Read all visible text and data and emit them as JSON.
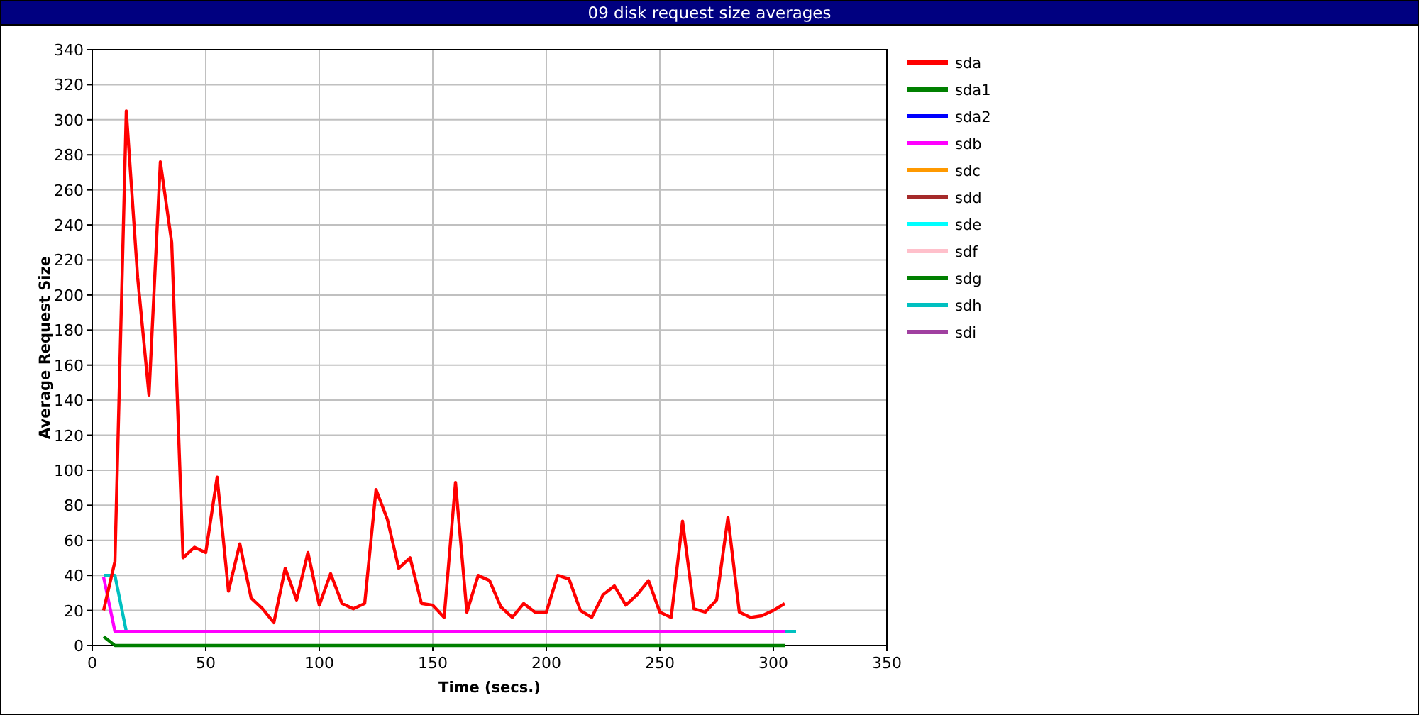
{
  "window": {
    "title": "09 disk request size averages"
  },
  "chart_data": {
    "type": "line",
    "grid": true,
    "legend": true,
    "xlabel": "Time (secs.)",
    "ylabel": "Average Request Size",
    "xlim": [
      0,
      350
    ],
    "ylim": [
      0,
      340
    ],
    "xticks": [
      0,
      50,
      100,
      150,
      200,
      250,
      300,
      350
    ],
    "yticks": [
      0,
      20,
      40,
      60,
      80,
      100,
      120,
      140,
      160,
      180,
      200,
      220,
      240,
      260,
      280,
      300,
      320,
      340
    ],
    "x": [
      5,
      10,
      15,
      20,
      25,
      30,
      35,
      40,
      45,
      50,
      55,
      60,
      65,
      70,
      75,
      80,
      85,
      90,
      95,
      100,
      105,
      110,
      115,
      120,
      125,
      130,
      135,
      140,
      145,
      150,
      155,
      160,
      165,
      170,
      175,
      180,
      185,
      190,
      195,
      200,
      205,
      210,
      215,
      220,
      225,
      230,
      235,
      240,
      245,
      250,
      255,
      260,
      265,
      270,
      275,
      280,
      285,
      290,
      295,
      300,
      305,
      310
    ],
    "series": [
      {
        "name": "sda",
        "color": "#ff0000",
        "values": [
          20,
          48,
          305,
          210,
          143,
          276,
          230,
          50,
          56,
          53,
          96,
          31,
          58,
          27,
          21,
          13,
          44,
          26,
          53,
          23,
          41,
          24,
          21,
          24,
          89,
          72,
          44,
          50,
          24,
          23,
          16,
          93,
          19,
          40,
          37,
          22,
          16,
          24,
          19,
          19,
          40,
          38,
          20,
          16,
          29,
          34,
          23,
          29,
          37,
          19,
          16,
          71,
          21,
          19,
          26,
          73,
          19,
          16,
          17,
          20,
          24,
          null
        ]
      },
      {
        "name": "sda1",
        "color": "#008000",
        "values": [
          null,
          null,
          null,
          null,
          null,
          null,
          null,
          null,
          null,
          null,
          null,
          null,
          null,
          null,
          null,
          null,
          null,
          null,
          null,
          null,
          null,
          null,
          null,
          null,
          null,
          null,
          null,
          null,
          null,
          null,
          null,
          null,
          null,
          null,
          null,
          null,
          null,
          null,
          null,
          null,
          null,
          null,
          null,
          null,
          null,
          null,
          null,
          null,
          null,
          null,
          null,
          null,
          null,
          null,
          null,
          null,
          null,
          null,
          null,
          null,
          null,
          null
        ]
      },
      {
        "name": "sda2",
        "color": "#0000ff",
        "values": [
          null,
          null,
          null,
          null,
          null,
          null,
          null,
          null,
          null,
          null,
          null,
          null,
          null,
          null,
          null,
          null,
          null,
          null,
          null,
          null,
          null,
          null,
          null,
          null,
          null,
          null,
          null,
          null,
          null,
          null,
          null,
          null,
          null,
          null,
          null,
          null,
          null,
          null,
          null,
          null,
          null,
          null,
          null,
          null,
          null,
          null,
          null,
          null,
          null,
          null,
          null,
          null,
          null,
          null,
          null,
          null,
          null,
          null,
          null,
          null,
          null,
          null
        ]
      },
      {
        "name": "sdb",
        "color": "#ff00ff",
        "values": [
          39,
          8,
          8,
          8,
          8,
          8,
          8,
          8,
          8,
          8,
          8,
          8,
          8,
          8,
          8,
          8,
          8,
          8,
          8,
          8,
          8,
          8,
          8,
          8,
          8,
          8,
          8,
          8,
          8,
          8,
          8,
          8,
          8,
          8,
          8,
          8,
          8,
          8,
          8,
          8,
          8,
          8,
          8,
          8,
          8,
          8,
          8,
          8,
          8,
          8,
          8,
          8,
          8,
          8,
          8,
          8,
          8,
          8,
          8,
          8,
          8,
          null
        ]
      },
      {
        "name": "sdc",
        "color": "#ff9900",
        "values": [
          null,
          null,
          null,
          null,
          null,
          null,
          null,
          null,
          null,
          null,
          null,
          null,
          null,
          null,
          null,
          null,
          null,
          null,
          null,
          null,
          null,
          null,
          null,
          null,
          null,
          null,
          null,
          null,
          null,
          null,
          null,
          null,
          null,
          null,
          null,
          null,
          null,
          null,
          null,
          null,
          null,
          null,
          null,
          null,
          null,
          null,
          null,
          null,
          null,
          null,
          null,
          null,
          null,
          null,
          null,
          null,
          null,
          null,
          null,
          null,
          null,
          null
        ]
      },
      {
        "name": "sdd",
        "color": "#a52a2a",
        "values": [
          null,
          null,
          null,
          null,
          null,
          null,
          null,
          null,
          null,
          null,
          null,
          null,
          null,
          null,
          null,
          null,
          null,
          null,
          null,
          null,
          null,
          null,
          null,
          null,
          null,
          null,
          null,
          null,
          null,
          null,
          null,
          null,
          null,
          null,
          null,
          null,
          null,
          null,
          null,
          null,
          null,
          null,
          null,
          null,
          null,
          null,
          null,
          null,
          null,
          null,
          null,
          null,
          null,
          null,
          null,
          null,
          null,
          null,
          null,
          null,
          null,
          null
        ]
      },
      {
        "name": "sde",
        "color": "#00ffff",
        "values": [
          null,
          null,
          null,
          null,
          null,
          null,
          null,
          null,
          null,
          null,
          null,
          null,
          null,
          null,
          null,
          null,
          null,
          null,
          null,
          null,
          null,
          null,
          null,
          null,
          null,
          null,
          null,
          null,
          null,
          null,
          null,
          null,
          null,
          null,
          null,
          null,
          null,
          null,
          null,
          null,
          null,
          null,
          null,
          null,
          null,
          null,
          null,
          null,
          null,
          null,
          null,
          null,
          null,
          null,
          null,
          null,
          null,
          null,
          null,
          null,
          null,
          null
        ]
      },
      {
        "name": "sdf",
        "color": "#ffc0cb",
        "values": [
          null,
          null,
          null,
          null,
          null,
          null,
          null,
          null,
          null,
          null,
          null,
          null,
          null,
          null,
          null,
          null,
          null,
          null,
          null,
          null,
          null,
          null,
          null,
          null,
          null,
          null,
          null,
          null,
          null,
          null,
          null,
          null,
          null,
          null,
          null,
          null,
          null,
          null,
          null,
          null,
          null,
          null,
          null,
          null,
          null,
          null,
          null,
          null,
          null,
          null,
          null,
          null,
          null,
          null,
          null,
          null,
          null,
          null,
          null,
          null,
          null,
          null
        ]
      },
      {
        "name": "sdg",
        "color": "#007f00",
        "values": [
          5,
          0,
          0,
          0,
          0,
          0,
          0,
          0,
          0,
          0,
          0,
          0,
          0,
          0,
          0,
          0,
          0,
          0,
          0,
          0,
          0,
          0,
          0,
          0,
          0,
          0,
          0,
          0,
          0,
          0,
          0,
          0,
          0,
          0,
          0,
          0,
          0,
          0,
          0,
          0,
          0,
          0,
          0,
          0,
          0,
          0,
          0,
          0,
          0,
          0,
          0,
          0,
          0,
          0,
          0,
          0,
          0,
          0,
          0,
          0,
          0,
          null
        ]
      },
      {
        "name": "sdh",
        "color": "#00c0c0",
        "values": [
          40,
          40,
          8,
          null,
          null,
          null,
          null,
          null,
          null,
          null,
          null,
          null,
          null,
          null,
          null,
          null,
          null,
          null,
          null,
          null,
          null,
          null,
          null,
          null,
          null,
          null,
          null,
          null,
          null,
          null,
          null,
          null,
          null,
          null,
          null,
          null,
          null,
          null,
          null,
          null,
          null,
          null,
          null,
          null,
          null,
          null,
          null,
          null,
          null,
          null,
          null,
          null,
          null,
          null,
          null,
          null,
          null,
          null,
          null,
          null,
          8,
          8
        ]
      },
      {
        "name": "sdi",
        "color": "#a040a0",
        "values": [
          null,
          null,
          null,
          null,
          null,
          null,
          null,
          null,
          null,
          null,
          null,
          null,
          null,
          null,
          null,
          null,
          null,
          null,
          null,
          null,
          null,
          null,
          null,
          null,
          null,
          null,
          null,
          null,
          null,
          null,
          null,
          null,
          null,
          null,
          null,
          null,
          null,
          null,
          null,
          null,
          null,
          null,
          null,
          null,
          null,
          null,
          null,
          null,
          null,
          null,
          null,
          null,
          null,
          null,
          null,
          null,
          null,
          null,
          null,
          null,
          null,
          null
        ]
      }
    ]
  }
}
